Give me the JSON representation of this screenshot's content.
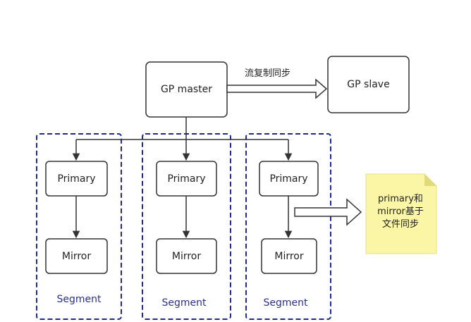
{
  "master": {
    "label": "GP master"
  },
  "slave": {
    "label": "GP slave"
  },
  "replication": {
    "label": "流复制同步"
  },
  "segments": [
    {
      "primary": "Primary",
      "mirror": "Mirror",
      "label": "Segment"
    },
    {
      "primary": "Primary",
      "mirror": "Mirror",
      "label": "Segment"
    },
    {
      "primary": "Primary",
      "mirror": "Mirror",
      "label": "Segment"
    }
  ],
  "note": {
    "lines": [
      "primary和",
      "mirror基于",
      "文件同步"
    ]
  },
  "colors": {
    "box_border": "#333333",
    "segment_border": "#1f2a8a",
    "note_fill": "#fbf6a6",
    "note_fold": "#e0da7a",
    "arrow": "#333333"
  }
}
